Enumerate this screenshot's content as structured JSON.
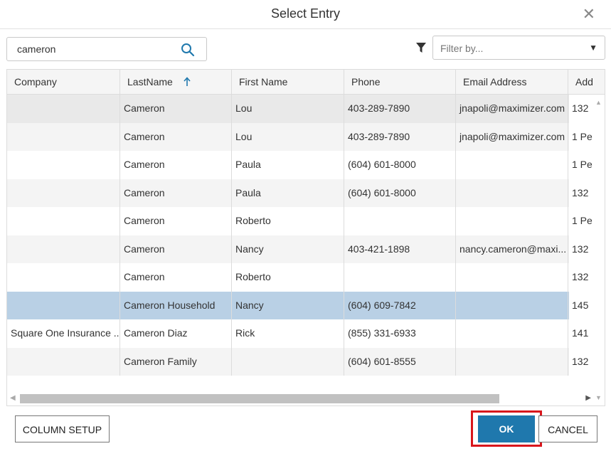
{
  "dialog": {
    "title": "Select Entry"
  },
  "search": {
    "value": "cameron"
  },
  "filter": {
    "placeholder": "Filter by..."
  },
  "columns": [
    "Company",
    "LastName",
    "First Name",
    "Phone",
    "Email Address",
    "Add"
  ],
  "sort": {
    "column": "LastName",
    "direction": "ascending"
  },
  "rows": [
    {
      "company": "",
      "last": "Cameron",
      "first": "Lou",
      "phone": "403-289-7890",
      "email": "jnapoli@maximizer.com",
      "addr": "132"
    },
    {
      "company": "",
      "last": "Cameron",
      "first": "Lou",
      "phone": "403-289-7890",
      "email": "jnapoli@maximizer.com",
      "addr": "1 Pe"
    },
    {
      "company": "",
      "last": "Cameron",
      "first": "Paula",
      "phone": "(604) 601-8000",
      "email": "",
      "addr": "1 Pe"
    },
    {
      "company": "",
      "last": "Cameron",
      "first": "Paula",
      "phone": "(604) 601-8000",
      "email": "",
      "addr": "132"
    },
    {
      "company": "",
      "last": "Cameron",
      "first": "Roberto",
      "phone": "",
      "email": "",
      "addr": "1 Pe"
    },
    {
      "company": "",
      "last": "Cameron",
      "first": "Nancy",
      "phone": "403-421-1898",
      "email": "nancy.cameron@maxi...",
      "addr": "132"
    },
    {
      "company": "",
      "last": "Cameron",
      "first": "Roberto",
      "phone": "",
      "email": "",
      "addr": "132"
    },
    {
      "company": "",
      "last": "Cameron Household",
      "first": "Nancy",
      "phone": "(604) 609-7842",
      "email": "",
      "addr": "145"
    },
    {
      "company": "Square One Insurance ...",
      "last": "Cameron Diaz",
      "first": "Rick",
      "phone": "(855) 331-6933",
      "email": "",
      "addr": "141"
    },
    {
      "company": "",
      "last": "Cameron Family",
      "first": "",
      "phone": "(604) 601-8555",
      "email": "",
      "addr": "132"
    }
  ],
  "selected_row": 7,
  "buttons": {
    "column_setup": "COLUMN SETUP",
    "ok": "OK",
    "cancel": "CANCEL"
  },
  "colors": {
    "accent": "#1f78ad",
    "selected_row": "#b9d0e5",
    "highlight": "#d9161c"
  },
  "icons": {
    "close": "close-icon",
    "search": "search-icon",
    "filter": "filter-icon",
    "sort": "sort-ascending-icon"
  }
}
